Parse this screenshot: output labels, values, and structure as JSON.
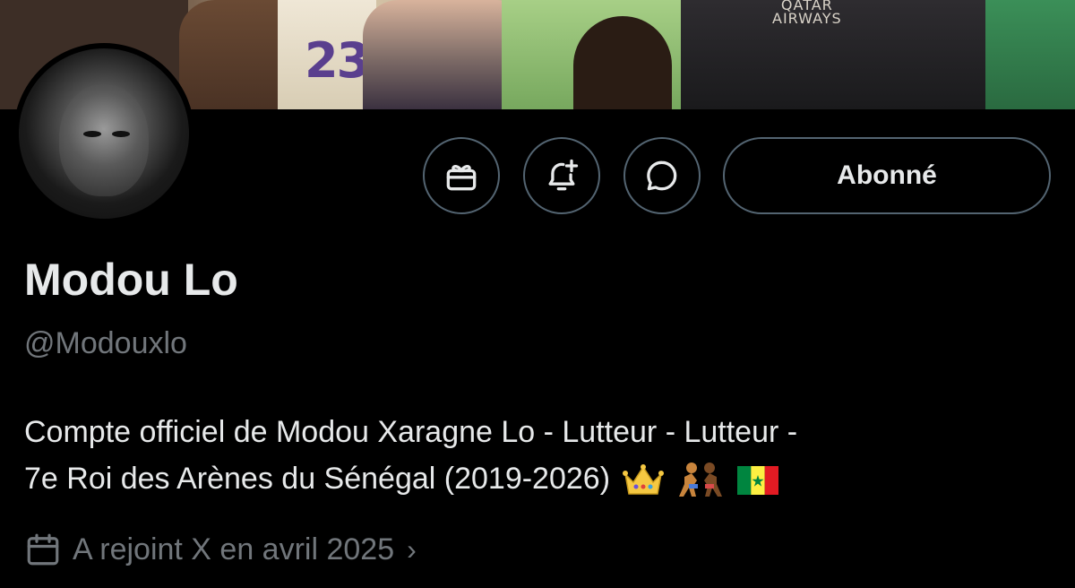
{
  "banner": {
    "jersey_number": "23",
    "sponsor_text": "QATAR\nAIRWAYS"
  },
  "actions": {
    "gift_icon": "gift-icon",
    "notify_icon": "bell-plus-icon",
    "message_icon": "message-icon",
    "follow_label": "Abonné"
  },
  "profile": {
    "name": "Modou Lo",
    "handle": "@Modouxlo",
    "bio_line1": "Compte officiel de Modou Xaragne Lo - Lutteur - Lutteur -",
    "bio_line2": "7e Roi des Arènes du Sénégal (2019-2026)",
    "bio_emojis": [
      "crown",
      "wrestlers",
      "senegal-flag"
    ],
    "joined": "A rejoint X en avril 2025",
    "joined_chevron": "›"
  },
  "colors": {
    "background": "#000000",
    "text": "#e7e9ea",
    "muted": "#71767b",
    "border": "#536471"
  }
}
